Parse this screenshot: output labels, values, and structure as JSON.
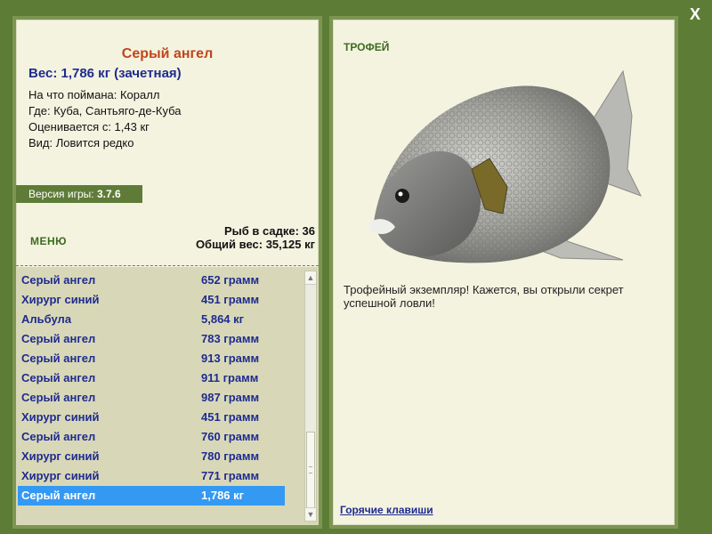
{
  "window": {
    "close_label": "X"
  },
  "fish": {
    "name": "Серый ангел",
    "weight_line": "Вес: 1,786 кг (зачетная)",
    "caught_on": "На что поймана: Коралл",
    "location": "Где: Куба, Сантьяго-де-Куба",
    "valued_from": "Оценивается с: 1,43 кг",
    "kind": "Вид: Ловится редко"
  },
  "version": {
    "label": "Версия игры: ",
    "number": "3.7.6"
  },
  "menu_label": "МЕНЮ",
  "cage": {
    "count_line": "Рыб в садке: 36",
    "total_line": "Общий вес: 35,125 кг"
  },
  "catches": [
    {
      "name": "Серый ангел",
      "weight": "652 грамм"
    },
    {
      "name": "Хирург синий",
      "weight": "451 грамм"
    },
    {
      "name": "Альбула",
      "weight": "5,864 кг"
    },
    {
      "name": "Серый ангел",
      "weight": "783 грамм"
    },
    {
      "name": "Серый ангел",
      "weight": "913 грамм"
    },
    {
      "name": "Серый ангел",
      "weight": "911 грамм"
    },
    {
      "name": "Серый ангел",
      "weight": "987 грамм"
    },
    {
      "name": "Хирург синий",
      "weight": "451 грамм"
    },
    {
      "name": "Серый ангел",
      "weight": "760 грамм"
    },
    {
      "name": "Хирург синий",
      "weight": "780 грамм"
    },
    {
      "name": "Хирург синий",
      "weight": "771 грамм"
    },
    {
      "name": "Серый ангел",
      "weight": "1,786 кг"
    }
  ],
  "selected_index": 11,
  "trophy": {
    "label": "ТРОФЕЙ",
    "message": "Трофейный экземпляр! Кажется, вы открыли секрет успешной ловли!"
  },
  "hotkeys_label": "Горячие клавиши",
  "colors": {
    "background": "#5d7d37",
    "panel": "#f4f3e0",
    "title": "#c0461a",
    "list_text": "#1f2b8f",
    "selection": "#3399f3"
  }
}
